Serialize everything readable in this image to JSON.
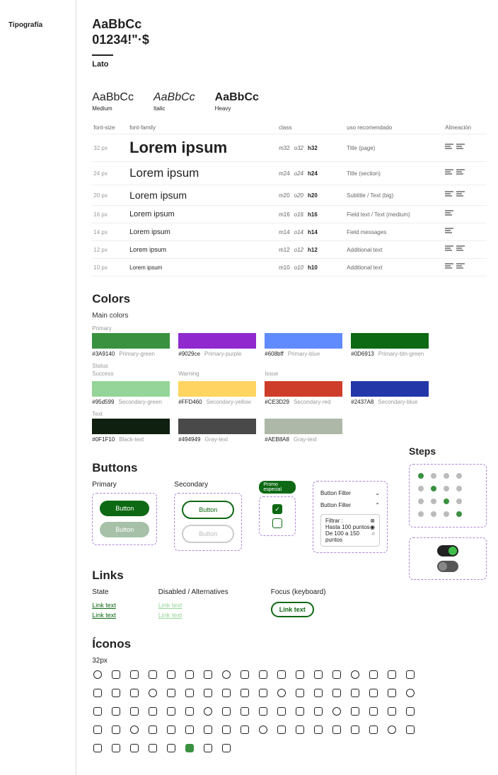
{
  "sidebar": {
    "label": "Tipografía"
  },
  "hero": {
    "sample1": "AaBbCc",
    "sample2": "01234!\"·$",
    "font": "Lato"
  },
  "weights": [
    {
      "sample": "AaBbCc",
      "label": "Medium",
      "style": "w-medium"
    },
    {
      "sample": "AaBbCc",
      "label": "Italic",
      "style": "w-italic"
    },
    {
      "sample": "AaBbCc",
      "label": "Heavy",
      "style": "w-heavy"
    }
  ],
  "typeTable": {
    "headers": [
      "font-size",
      "font-family",
      "class",
      "uso recomendado",
      "Alineación"
    ],
    "rows": [
      {
        "size": "32 px",
        "sample": "Lorem ipsum",
        "sclass": "sample-32",
        "m": "m32",
        "o": "o32",
        "h": "h32",
        "use": "Title (page)",
        "align": 2
      },
      {
        "size": "24 px",
        "sample": "Lorem ipsum",
        "sclass": "sample-24",
        "m": "m24",
        "o": "o24",
        "h": "h24",
        "use": "Title (section)",
        "align": 2
      },
      {
        "size": "20 px",
        "sample": "Lorem ipsum",
        "sclass": "sample-20",
        "m": "m20",
        "o": "o20",
        "h": "h20",
        "use": "Subtitle / Text (big)",
        "align": 2
      },
      {
        "size": "16 px",
        "sample": "Lorem ipsum",
        "sclass": "sample-16",
        "m": "m16",
        "o": "o16",
        "h": "h16",
        "use": "Field text / Text (medium)",
        "align": 1
      },
      {
        "size": "14 px",
        "sample": "Lorem ipsum",
        "sclass": "sample-14",
        "m": "m14",
        "o": "o14",
        "h": "h14",
        "use": "Field messages",
        "align": 1
      },
      {
        "size": "12 px",
        "sample": "Lorem ipsum",
        "sclass": "sample-12",
        "m": "m12",
        "o": "o12",
        "h": "h12",
        "use": "Additional text",
        "align": 2
      },
      {
        "size": "10 px",
        "sample": "Lorem ipsum",
        "sclass": "sample-10",
        "m": "m10",
        "o": "o10",
        "h": "h10",
        "use": "Additional text",
        "align": 2
      }
    ]
  },
  "colors": {
    "title": "Colors",
    "mainTitle": "Main colors",
    "sections": [
      {
        "label": "Primary",
        "swatches": [
          {
            "hex": "#3A9140",
            "name": "Primary-green"
          },
          {
            "hex": "#9029ce",
            "name": "Primary-purple"
          },
          {
            "hex": "#608bff",
            "name": "Primary-blue"
          },
          {
            "hex": "#0D6913",
            "name": "Primary-btn-green"
          }
        ]
      },
      {
        "label": "Status",
        "subs": [
          "Success",
          "Warning",
          "Issue",
          ""
        ],
        "swatches": [
          {
            "hex": "#95d599",
            "name": "Secondary-green"
          },
          {
            "hex": "#FFD460",
            "name": "Secondary-yellow"
          },
          {
            "hex": "#CE3D29",
            "name": "Secondary-red"
          },
          {
            "hex": "#2437A8",
            "name": "Secondary-blue"
          }
        ]
      },
      {
        "label": "Text",
        "swatches": [
          {
            "hex": "#0F1F10",
            "name": "Black-text"
          },
          {
            "hex": "#494949",
            "name": "Gray-text"
          },
          {
            "hex": "#AEB8A8",
            "name": "Gray-text"
          }
        ]
      }
    ]
  },
  "buttons": {
    "title": "Buttons",
    "primary": "Primary",
    "secondary": "Secondary",
    "label": "Button",
    "promo": "Promo especial"
  },
  "filter": {
    "row1": "Button Filter",
    "row2": "Button Filter",
    "subTitle": "Filtrar :",
    "opt1": "Hasta 100 puntos",
    "opt2": "De 100 a 150 puntos"
  },
  "steps": {
    "title": "Steps"
  },
  "links": {
    "title": "Links",
    "cols": {
      "state": "State",
      "disabled": "Disabled / Alternatives",
      "focus": "Focus (keyboard)"
    },
    "text": "Link text"
  },
  "icons": {
    "title": "Íconos",
    "size": "32px",
    "count": 80
  }
}
